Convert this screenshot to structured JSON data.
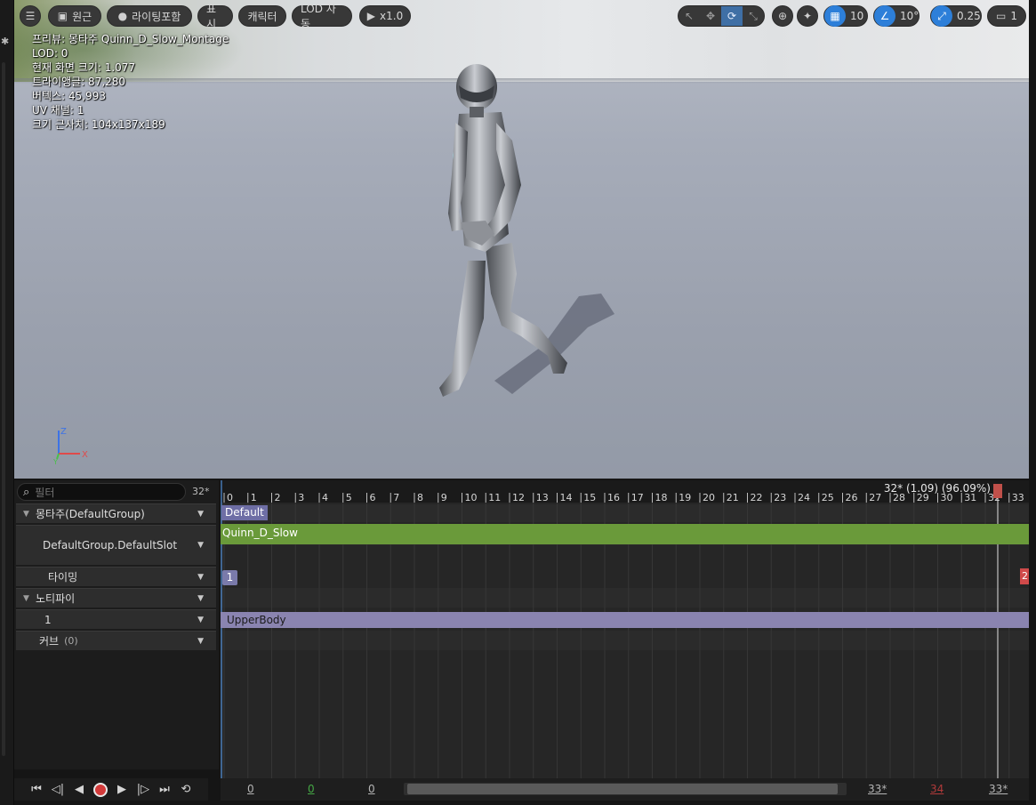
{
  "toolbar": {
    "menu_icon": "menu-icon",
    "perspective_label": "원근",
    "lighting_label": "라이팅포함",
    "show_label": "표시",
    "character_label": "캐릭터",
    "lod_label": "LOD 자동",
    "play_speed_label": "x1.0",
    "grid_snap_value": "10",
    "rotation_snap_value": "10°",
    "scale_snap_value": "0.25",
    "camera_speed_value": "1"
  },
  "viewport_info": {
    "line1": "프리뷰: 몽타주 Quinn_D_Slow_Montage",
    "line2": "LOD: 0",
    "line3": "현재 화면 크기: 1.077",
    "line4": "트라이앵글: 87,280",
    "line5": "버텍스: 45,993",
    "line6": "UV 채널: 1",
    "line7": "크기 근사치: 104x137x189"
  },
  "gizmo": {
    "z": "Z",
    "x": "X",
    "y": "Y"
  },
  "left_panel": {
    "search_placeholder": "필터",
    "search_count": "32*",
    "tracks": [
      {
        "label": "몽타주(DefaultGroup)"
      },
      {
        "label": "DefaultGroup.DefaultSlot"
      },
      {
        "label": "타이밍"
      },
      {
        "label": "노티파이"
      },
      {
        "label": "1"
      },
      {
        "label": "커브",
        "count": "(0)"
      }
    ]
  },
  "timeline": {
    "frame_readout": "32* (1.09) (96.09%)",
    "ruler_ticks": [
      "0",
      "1",
      "2",
      "3",
      "4",
      "5",
      "6",
      "7",
      "8",
      "9",
      "10",
      "11",
      "12",
      "13",
      "14",
      "15",
      "16",
      "17",
      "18",
      "19",
      "20",
      "21",
      "22",
      "23",
      "24",
      "25",
      "26",
      "27",
      "28",
      "29",
      "30",
      "31",
      "32",
      "33"
    ],
    "section_label": "Default",
    "segment_label": "Quinn_D_Slow",
    "notify_marker": "1",
    "notify_end_marker": "2",
    "notify_track_label": "UpperBody"
  },
  "bottom_bar": {
    "start_view": "0",
    "start_play": "0",
    "start_select": "0",
    "end_select": "33*",
    "end_play": "34",
    "end_view": "33*"
  },
  "colors": {
    "segment_green": "#6a9a3a",
    "section_purple": "#6e6ea5",
    "notify_purple": "#8a84b0",
    "accent_blue": "#2d7fd9",
    "end_red": "#d04a4a"
  }
}
